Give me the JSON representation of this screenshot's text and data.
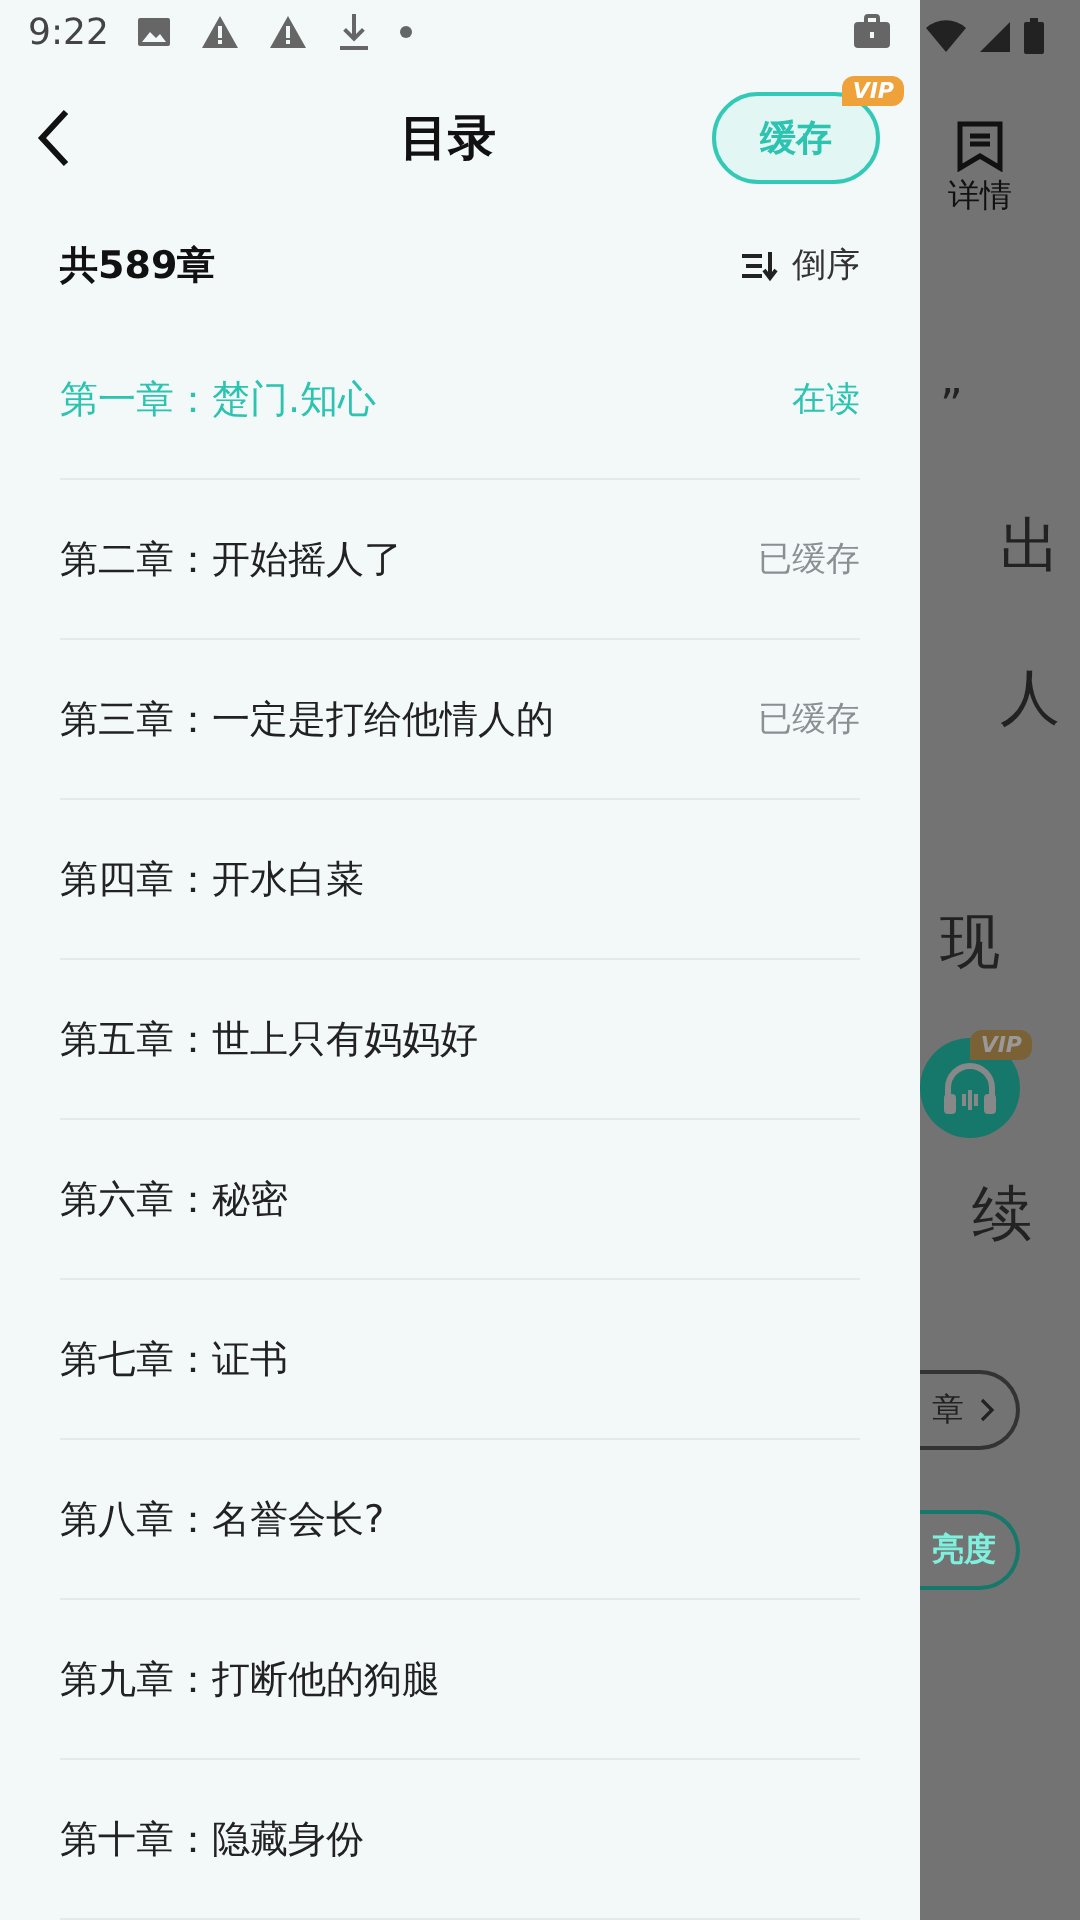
{
  "status_bar": {
    "time": "9:22"
  },
  "header": {
    "title": "目录",
    "cache_button": "缓存",
    "cache_badge": "VIP"
  },
  "summary": {
    "count": "共589章",
    "sort_label": "倒序"
  },
  "chapters": [
    {
      "title": "第一章：楚门.知心",
      "status": "在读",
      "selected": true
    },
    {
      "title": "第二章：开始摇人了",
      "status": "已缓存",
      "selected": false
    },
    {
      "title": "第三章：一定是打给他情人的",
      "status": "已缓存",
      "selected": false
    },
    {
      "title": "第四章：开水白菜",
      "selected": false
    },
    {
      "title": "第五章：世上只有妈妈好",
      "selected": false
    },
    {
      "title": "第六章：秘密",
      "selected": false
    },
    {
      "title": "第七章：证书",
      "selected": false
    },
    {
      "title": "第八章：名誉会长?",
      "selected": false
    },
    {
      "title": "第九章：打断他的狗腿",
      "selected": false
    },
    {
      "title": "第十章：隐藏身份",
      "selected": false
    }
  ],
  "background_page": {
    "tab_label": "详情",
    "fragments": [
      "”",
      "出",
      "人",
      "现"
    ],
    "audio_badge": "VIP",
    "fragment_after": "续",
    "chips": [
      {
        "label": "章",
        "kind": "next"
      },
      {
        "label": "亮度",
        "kind": "accent"
      }
    ]
  }
}
